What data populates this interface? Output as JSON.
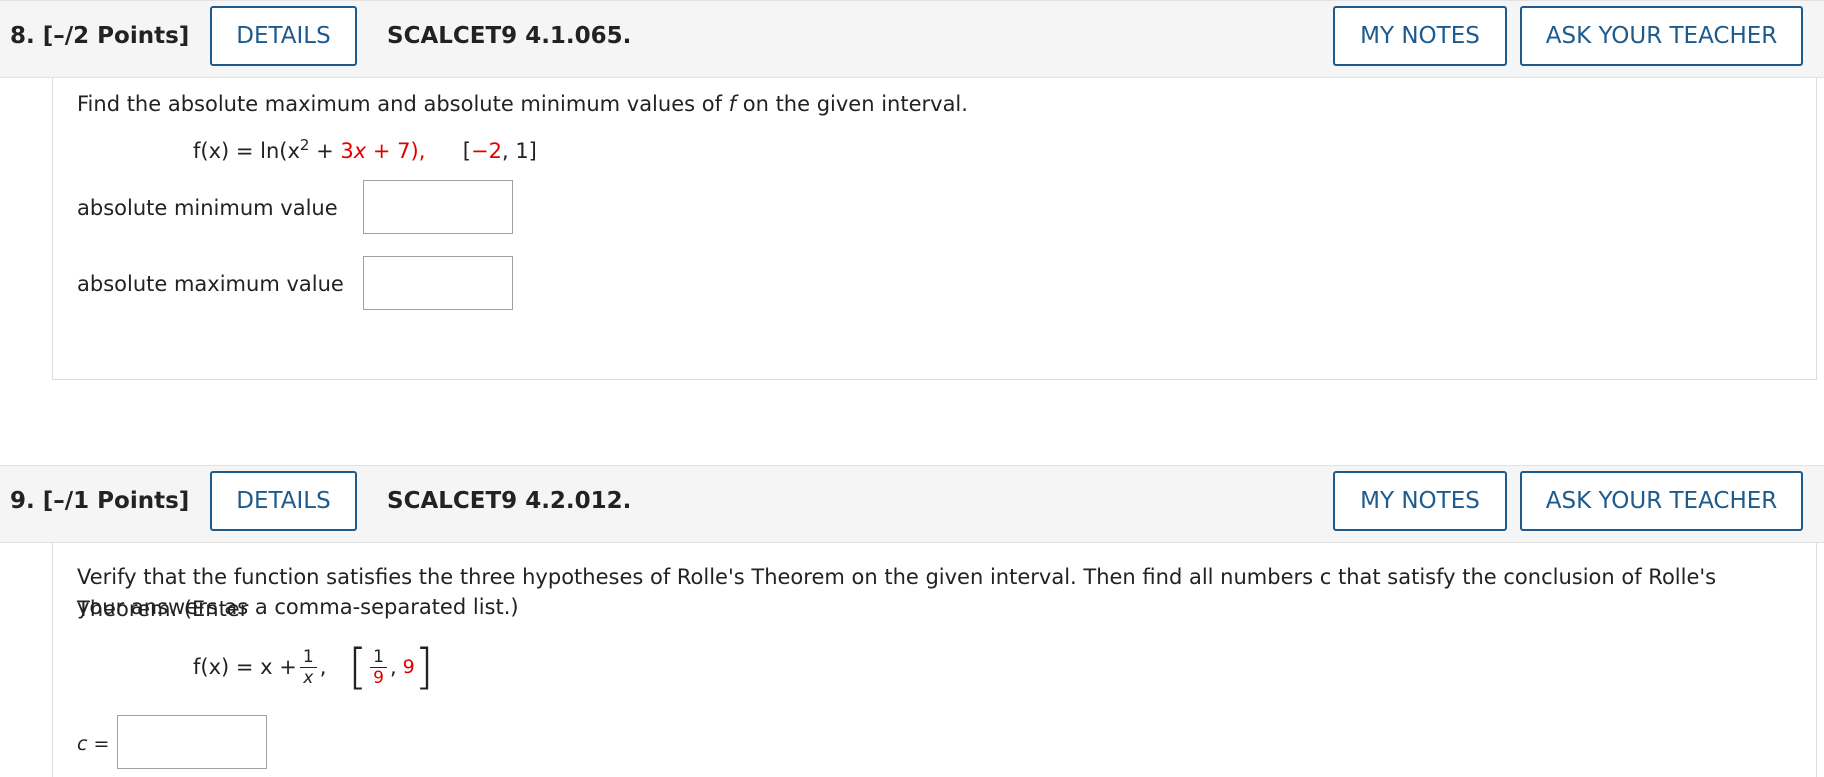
{
  "q8": {
    "number": "8.  [–/2 Points]",
    "details_label": "DETAILS",
    "code": "SCALCET9 4.1.065.",
    "my_notes_label": "MY NOTES",
    "ask_teacher_label": "ASK YOUR TEACHER",
    "prompt_pre": "Find the absolute maximum and absolute minimum values of ",
    "prompt_var": "f",
    "prompt_post": " on the given interval.",
    "formula_lhs": "f(x) = ln(x",
    "formula_exp": "2",
    "formula_plus1": " + ",
    "formula_coef": "3",
    "formula_x": "x + ",
    "formula_const": "7",
    "formula_close": "),",
    "interval_open": "[",
    "interval_a": "−2",
    "interval_sep": ", 1]",
    "min_label": "absolute minimum value",
    "max_label": "absolute maximum value",
    "min_value": "",
    "max_value": ""
  },
  "q9": {
    "number": "9.  [–/1 Points]",
    "details_label": "DETAILS",
    "code": "SCALCET9 4.2.012.",
    "my_notes_label": "MY NOTES",
    "ask_teacher_label": "ASK YOUR TEACHER",
    "prompt_line1": "Verify that the function satisfies the three hypotheses of Rolle's Theorem on the given interval. Then find all numbers c that satisfy the conclusion of Rolle's Theorem. (Enter",
    "prompt_line2": "your answers as a comma-separated list.)",
    "formula_lhs": "f(x) = x + ",
    "frac_num": "1",
    "frac_den": "x",
    "comma": ",",
    "int_num": "1",
    "int_den": "9",
    "int_upper": "9",
    "c_label": "c =",
    "c_value": ""
  }
}
